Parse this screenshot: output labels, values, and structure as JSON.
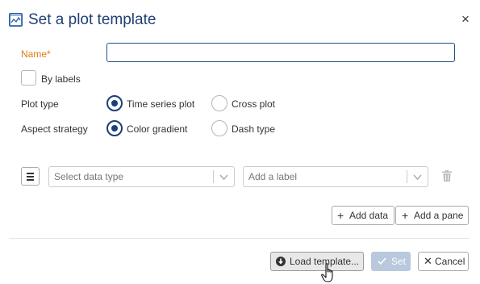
{
  "dialog": {
    "title": "Set a plot template",
    "close_label": "×"
  },
  "form": {
    "name_label": "Name",
    "name_required_mark": "*",
    "name_value": "",
    "by_labels_label": "By labels",
    "by_labels_checked": false,
    "plot_type_label": "Plot type",
    "plot_type_options": [
      "Time series plot",
      "Cross plot"
    ],
    "plot_type_selected": "Time series plot",
    "aspect_strategy_label": "Aspect strategy",
    "aspect_strategy_options": [
      "Color gradient",
      "Dash type"
    ],
    "aspect_strategy_selected": "Color gradient"
  },
  "data_row": {
    "data_type_placeholder": "Select data type",
    "label_placeholder": "Add a label"
  },
  "actions": {
    "add_data_label": "Add data",
    "add_pane_label": "Add a pane",
    "load_template_label": "Load template...",
    "set_label": "Set",
    "set_enabled": false,
    "cancel_label": "Cancel"
  },
  "colors": {
    "title": "#1f3f73",
    "required": "#e07a10",
    "radio_selected": "#1a3f7a",
    "set_disabled_bg": "#b8c8dd"
  }
}
